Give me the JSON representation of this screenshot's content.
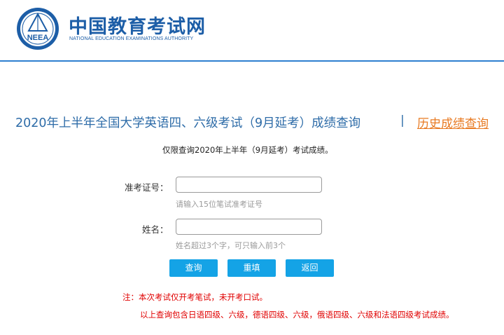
{
  "header": {
    "logo_text": "NEEA",
    "site_name": "中国教育考试网",
    "site_subtitle": "NATIONAL EDUCATION EXAMINATIONS AUTHORITY"
  },
  "main": {
    "title": "2020年上半年全国大学英语四、六级考试（9月延考）成绩查询",
    "separator": "|",
    "history_link": "历史成绩查询",
    "subtitle": "仅限查询2020年上半年（9月延考）考试成绩。"
  },
  "form": {
    "ticket_label": "准考证号：",
    "ticket_value": "",
    "ticket_hint": "请输入15位笔试准考证号",
    "name_label": "姓名：",
    "name_value": "",
    "name_hint": "姓名超过3个字，可只输入前3个"
  },
  "buttons": {
    "query": "查询",
    "reset": "重填",
    "back": "返回"
  },
  "notes": {
    "line1": "注：本次考试仅开考笔试，未开考口试。",
    "line2": "以上查询包含日语四级、六级，德语四级、六级，俄语四级、六级和法语四级考试成绩。"
  },
  "colors": {
    "brand_blue": "#1d5ea7",
    "title_blue": "#2e6ca8",
    "link_orange": "#e87a22",
    "button_blue": "#14a3e6",
    "note_red": "#e00000"
  }
}
